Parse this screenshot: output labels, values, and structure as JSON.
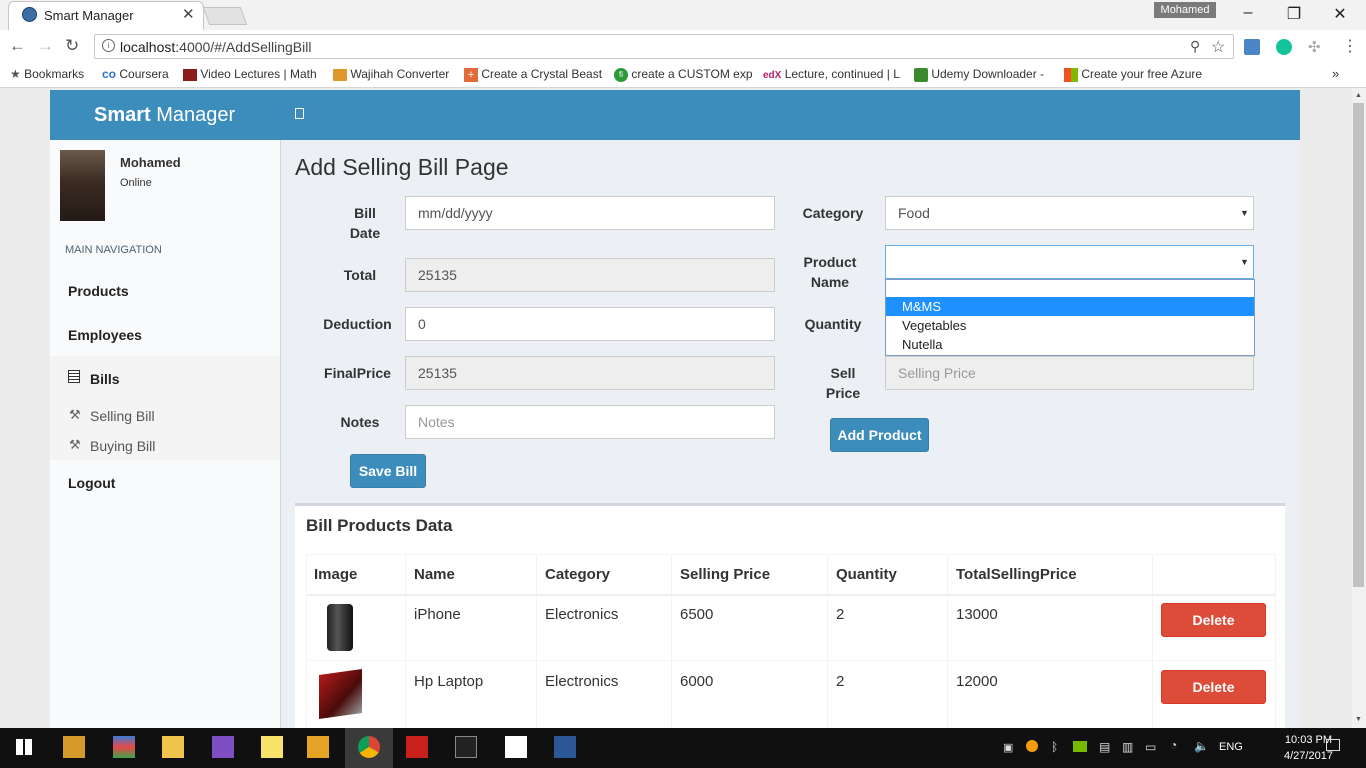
{
  "browser": {
    "tab_title": "Smart Manager",
    "profile_name": "Mohamed",
    "url_host": "localhost",
    "url_path": ":4000/#/AddSellingBill",
    "bookmarks": [
      {
        "label": "Bookmarks",
        "icon": "star-icon"
      },
      {
        "label": "Coursera",
        "icon": "coursera-icon"
      },
      {
        "label": "Video Lectures | Math",
        "icon": "mit-icon"
      },
      {
        "label": "Wajihah Converter",
        "icon": "converter-icon"
      },
      {
        "label": "Create a Crystal Beast",
        "icon": "plus-square-icon"
      },
      {
        "label": "create a CUSTOM exp",
        "icon": "fi-icon"
      },
      {
        "label": "Lecture, continued | L",
        "icon": "edx-icon"
      },
      {
        "label": "Udemy Downloader -",
        "icon": "udemy-icon"
      },
      {
        "label": "Create your free Azure",
        "icon": "microsoft-icon"
      }
    ]
  },
  "app": {
    "brand_bold": "Smart",
    "brand_rest": " Manager",
    "user": {
      "name": "Mohamed",
      "status": "Online"
    },
    "nav_header": "MAIN NAVIGATION",
    "nav": {
      "products": "Products",
      "employees": "Employees",
      "bills": "Bills",
      "selling_bill": "Selling Bill",
      "buying_bill": "Buying Bill",
      "logout": "Logout"
    }
  },
  "form": {
    "page_title": "Add Selling Bill Page",
    "bill_date_label_1": "Bill",
    "bill_date_label_2": "Date",
    "bill_date_placeholder": "mm/dd/yyyy",
    "total_label": "Total",
    "total_value": "25135",
    "deduction_label": "Deduction",
    "deduction_value": "0",
    "final_price_label": "FinalPrice",
    "final_price_value": "25135",
    "notes_label": "Notes",
    "notes_placeholder": "Notes",
    "save_button": "Save Bill",
    "category_label": "Category",
    "category_value": "Food",
    "product_name_label_1": "Product",
    "product_name_label_2": "Name",
    "product_options": [
      "M&MS",
      "Vegetables",
      "Nutella"
    ],
    "product_highlighted": "M&MS",
    "quantity_label": "Quantity",
    "sell_price_label_1": "Sell",
    "sell_price_label_2": "Price",
    "sell_price_placeholder": "Selling Price",
    "add_product_button": "Add Product"
  },
  "table": {
    "title": "Bill Products Data",
    "columns": [
      "Image",
      "Name",
      "Category",
      "Selling Price",
      "Quantity",
      "TotalSellingPrice"
    ],
    "rows": [
      {
        "image": "iphone-image",
        "name": "iPhone",
        "category": "Electronics",
        "selling_price": "6500",
        "quantity": "2",
        "total": "13000",
        "action": "Delete"
      },
      {
        "image": "laptop-image",
        "name": "Hp Laptop",
        "category": "Electronics",
        "selling_price": "6000",
        "quantity": "2",
        "total": "12000",
        "action": "Delete"
      }
    ]
  },
  "taskbar": {
    "language": "ENG",
    "time": "10:03 PM",
    "date": "4/27/2017"
  }
}
